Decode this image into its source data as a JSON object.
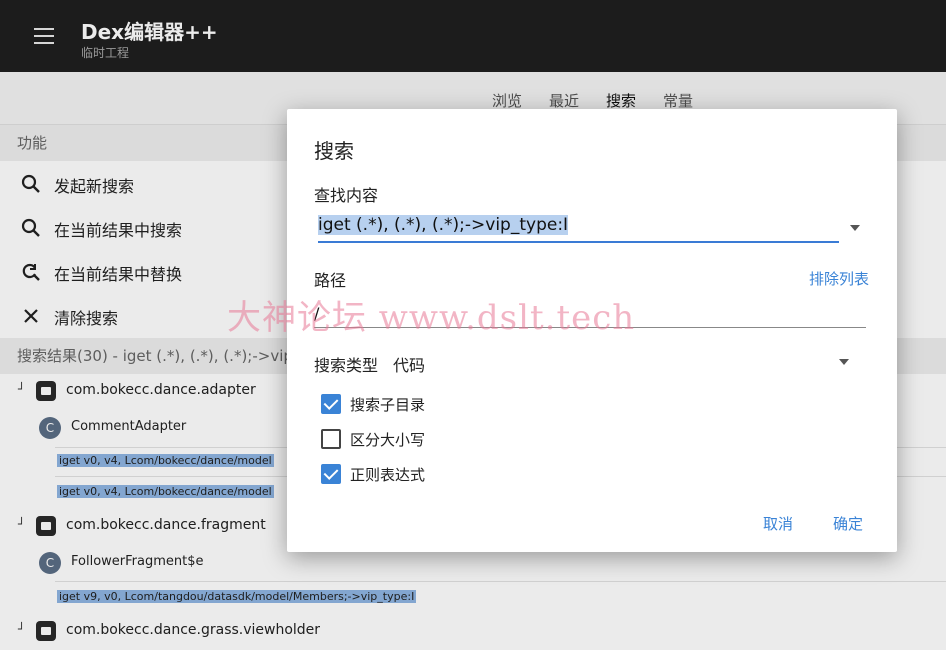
{
  "app": {
    "title": "Dex编辑器++",
    "subtitle": "临时工程"
  },
  "tabs": [
    "浏览",
    "最近",
    "搜索",
    "常量"
  ],
  "sidebar": {
    "section_title": "功能",
    "items": [
      {
        "label": "发起新搜索",
        "icon": "search-icon"
      },
      {
        "label": "在当前结果中搜索",
        "icon": "search-icon"
      },
      {
        "label": "在当前结果中替换",
        "icon": "replace-icon"
      },
      {
        "label": "清除搜索",
        "icon": "close-icon"
      }
    ]
  },
  "results": {
    "header": "搜索结果(30) - iget (.*), (.*), (.*);->vip",
    "packages": [
      "com.bokecc.dance.adapter",
      "com.bokecc.dance.fragment",
      "com.bokecc.dance.grass.viewholder"
    ],
    "classes": [
      "CommentAdapter",
      "FollowerFragment$e"
    ],
    "class_badge": "C",
    "code_lines": [
      "iget v0, v4, Lcom/bokecc/dance/model",
      "iget v0, v4, Lcom/bokecc/dance/model",
      "iget v9, v0, Lcom/tangdou/datasdk/model/Members;->vip_type:I"
    ],
    "tree_marker": "┘"
  },
  "dialog": {
    "title": "搜索",
    "find_label": "查找内容",
    "find_value": "iget (.*), (.*), (.*);->vip_type:I",
    "path_label": "路径",
    "exclude_list": "排除列表",
    "path_value": "/",
    "search_type_label": "搜索类型",
    "search_type_value": "代码",
    "checkboxes": [
      {
        "label": "搜索子目录",
        "checked": true
      },
      {
        "label": "区分大小写",
        "checked": false
      },
      {
        "label": "正则表达式",
        "checked": true
      }
    ],
    "cancel": "取消",
    "confirm": "确定"
  },
  "watermark": "大神论坛 www.dslt.tech",
  "colors": {
    "appbar": "#1f1f1f",
    "accent": "#3a83d6",
    "code_highlight": "#8fb5e2"
  }
}
